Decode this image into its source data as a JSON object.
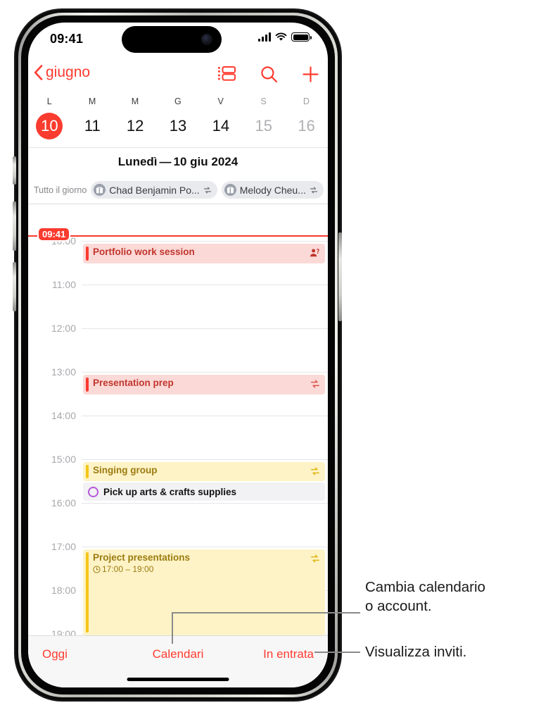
{
  "status_bar": {
    "time": "09:41",
    "signal_icon": "cellular-bars-icon",
    "wifi_icon": "wifi-icon",
    "battery_icon": "battery-icon"
  },
  "nav": {
    "back_label": "giugno",
    "back_icon": "chevron-left-icon",
    "view_switch_icon": "list-view-icon",
    "search_icon": "search-icon",
    "add_icon": "plus-icon"
  },
  "week": {
    "days": [
      {
        "dow": "L",
        "num": "10",
        "selected": true,
        "dim": false
      },
      {
        "dow": "M",
        "num": "11",
        "selected": false,
        "dim": false
      },
      {
        "dow": "M",
        "num": "12",
        "selected": false,
        "dim": false
      },
      {
        "dow": "G",
        "num": "13",
        "selected": false,
        "dim": false
      },
      {
        "dow": "V",
        "num": "14",
        "selected": false,
        "dim": false
      },
      {
        "dow": "S",
        "num": "15",
        "selected": false,
        "dim": true
      },
      {
        "dow": "D",
        "num": "16",
        "selected": false,
        "dim": true
      }
    ]
  },
  "day_header": {
    "weekday": "Lunedì",
    "separator": "—",
    "date": "10 giu 2024"
  },
  "all_day": {
    "label": "Tutto il giorno",
    "chips": [
      {
        "title": "Chad Benjamin Po...",
        "icon": "gift-icon",
        "repeat_icon": "repeat-icon"
      },
      {
        "title": "Melody Cheu...",
        "icon": "gift-icon",
        "repeat_icon": "repeat-icon"
      }
    ]
  },
  "timeline": {
    "now_label": "09:41",
    "hours": [
      "10:00",
      "11:00",
      "12:00",
      "13:00",
      "14:00",
      "15:00",
      "16:00",
      "17:00",
      "18:00",
      "19:00"
    ],
    "events": [
      {
        "title": "Portfolio work session",
        "time": "",
        "color": "red",
        "accent": "#fa3b2f",
        "bg": "#fbd9d7",
        "text": "#c0352c",
        "icon": "person-question-icon"
      },
      {
        "title": "Presentation prep",
        "time": "",
        "color": "red",
        "accent": "#fa3b2f",
        "bg": "#fbd9d7",
        "text": "#c0352c",
        "icon": "repeat-icon"
      },
      {
        "title": "Singing group",
        "time": "",
        "color": "yellow",
        "accent": "#f5c518",
        "bg": "#fdf3c6",
        "text": "#9c7b10",
        "icon": "repeat-icon"
      },
      {
        "title": "Project presentations",
        "time": "17:00 – 19:00",
        "color": "yellow",
        "accent": "#f5c518",
        "bg": "#fdf3c6",
        "text": "#9c7b10",
        "icon": "repeat-icon",
        "clock_icon": "clock-icon"
      }
    ],
    "reminders": [
      {
        "title": "Pick up arts & crafts supplies",
        "circle_icon": "circle-checkbox-icon",
        "circle_color": "#b659d8"
      }
    ]
  },
  "tab_bar": {
    "today": "Oggi",
    "calendars": "Calendari",
    "inbox": "In entrata"
  },
  "callouts": [
    {
      "text_line1": "Cambia calendario",
      "text_line2": "o account."
    },
    {
      "text_line1": "Visualizza inviti.",
      "text_line2": ""
    }
  ]
}
